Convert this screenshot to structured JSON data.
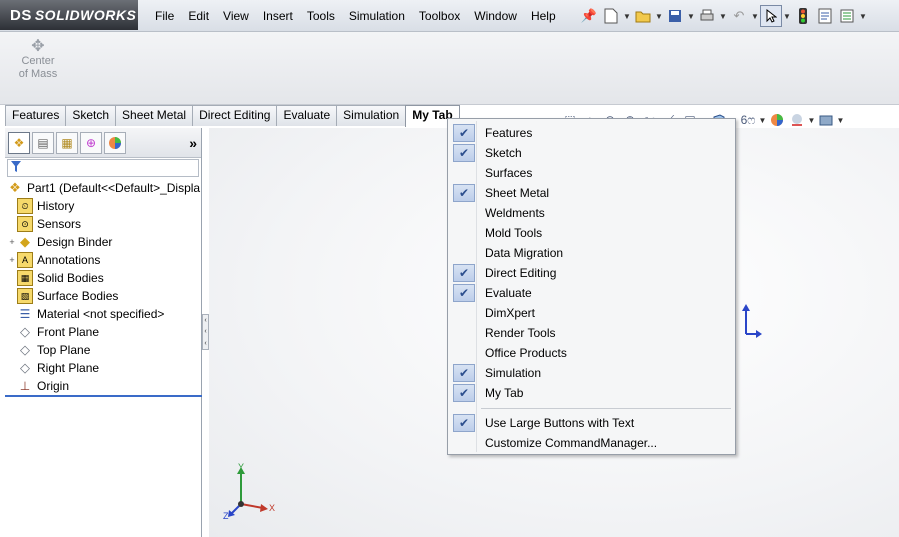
{
  "app": {
    "brand": "SOLIDWORKS",
    "brand_mark": "DS"
  },
  "menubar": {
    "items": [
      "File",
      "Edit",
      "View",
      "Insert",
      "Tools",
      "Simulation",
      "Toolbox",
      "Window",
      "Help"
    ]
  },
  "toolbar": {
    "icons": [
      "pin-icon",
      "new-document-icon",
      "open-folder-icon",
      "save-icon",
      "print-icon",
      "undo-icon",
      "select-arrow-icon",
      "traffic-light-icon",
      "file-properties-icon",
      "options-icon"
    ]
  },
  "ribbon": {
    "button_label_1": "Center",
    "button_label_2": "of Mass"
  },
  "tabs": [
    "Features",
    "Sketch",
    "Sheet Metal",
    "Direct Editing",
    "Evaluate",
    "Simulation",
    "My Tab"
  ],
  "active_tab": "My Tab",
  "feature_manager": {
    "more": "»",
    "root": "Part1  (Default<<Default>_Displa",
    "items": [
      {
        "label": "History",
        "icon": "history-icon",
        "expand": ""
      },
      {
        "label": "Sensors",
        "icon": "sensors-icon",
        "expand": ""
      },
      {
        "label": "Design Binder",
        "icon": "design-binder-icon",
        "expand": "+"
      },
      {
        "label": "Annotations",
        "icon": "annotations-icon",
        "expand": "+"
      },
      {
        "label": "Solid Bodies",
        "icon": "solid-bodies-icon",
        "expand": ""
      },
      {
        "label": "Surface Bodies",
        "icon": "surface-bodies-icon",
        "expand": ""
      },
      {
        "label": "Material <not specified>",
        "icon": "material-icon",
        "expand": ""
      },
      {
        "label": "Front Plane",
        "icon": "plane-icon",
        "expand": ""
      },
      {
        "label": "Top Plane",
        "icon": "plane-icon",
        "expand": ""
      },
      {
        "label": "Right Plane",
        "icon": "plane-icon",
        "expand": ""
      },
      {
        "label": "Origin",
        "icon": "origin-icon",
        "expand": ""
      }
    ]
  },
  "triad": {
    "x": "X",
    "y": "Y",
    "z": "Z"
  },
  "context_menu": {
    "items": [
      {
        "label": "Features",
        "checked": true
      },
      {
        "label": "Sketch",
        "checked": true
      },
      {
        "label": "Surfaces",
        "checked": false
      },
      {
        "label": "Sheet Metal",
        "checked": true
      },
      {
        "label": "Weldments",
        "checked": false
      },
      {
        "label": "Mold Tools",
        "checked": false
      },
      {
        "label": "Data Migration",
        "checked": false
      },
      {
        "label": "Direct Editing",
        "checked": true
      },
      {
        "label": "Evaluate",
        "checked": true
      },
      {
        "label": "DimXpert",
        "checked": false
      },
      {
        "label": "Render Tools",
        "checked": false
      },
      {
        "label": "Office Products",
        "checked": false
      },
      {
        "label": "Simulation",
        "checked": true
      },
      {
        "label": "My Tab",
        "checked": true
      }
    ],
    "options": [
      {
        "label": "Use Large Buttons with Text",
        "checked": true
      },
      {
        "label": "Customize CommandManager...",
        "checked": false
      }
    ],
    "check_glyph": "✔"
  },
  "colors": {
    "brand_bar": "#2d3036",
    "selection_blue": "#3a6bc8",
    "check_bg": "#bccdea",
    "axis_x": "#c0392b",
    "axis_y": "#2e9a3a",
    "axis_z": "#2a45c8"
  }
}
